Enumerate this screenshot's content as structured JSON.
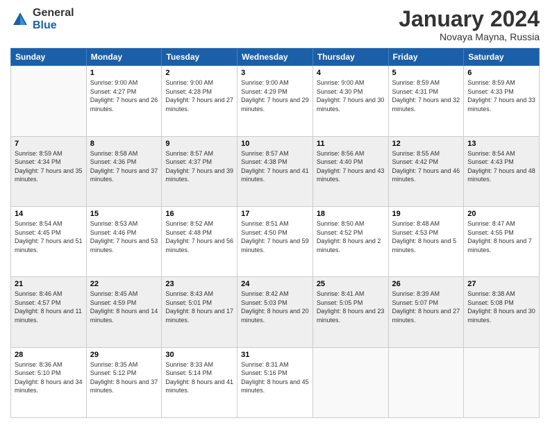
{
  "logo": {
    "general": "General",
    "blue": "Blue"
  },
  "header": {
    "month_year": "January 2024",
    "location": "Novaya Mayna, Russia"
  },
  "days_of_week": [
    "Sunday",
    "Monday",
    "Tuesday",
    "Wednesday",
    "Thursday",
    "Friday",
    "Saturday"
  ],
  "weeks": [
    [
      {
        "day": "",
        "sunrise": "",
        "sunset": "",
        "daylight": ""
      },
      {
        "day": "1",
        "sunrise": "Sunrise: 9:00 AM",
        "sunset": "Sunset: 4:27 PM",
        "daylight": "Daylight: 7 hours and 26 minutes."
      },
      {
        "day": "2",
        "sunrise": "Sunrise: 9:00 AM",
        "sunset": "Sunset: 4:28 PM",
        "daylight": "Daylight: 7 hours and 27 minutes."
      },
      {
        "day": "3",
        "sunrise": "Sunrise: 9:00 AM",
        "sunset": "Sunset: 4:29 PM",
        "daylight": "Daylight: 7 hours and 29 minutes."
      },
      {
        "day": "4",
        "sunrise": "Sunrise: 9:00 AM",
        "sunset": "Sunset: 4:30 PM",
        "daylight": "Daylight: 7 hours and 30 minutes."
      },
      {
        "day": "5",
        "sunrise": "Sunrise: 8:59 AM",
        "sunset": "Sunset: 4:31 PM",
        "daylight": "Daylight: 7 hours and 32 minutes."
      },
      {
        "day": "6",
        "sunrise": "Sunrise: 8:59 AM",
        "sunset": "Sunset: 4:33 PM",
        "daylight": "Daylight: 7 hours and 33 minutes."
      }
    ],
    [
      {
        "day": "7",
        "sunrise": "Sunrise: 8:59 AM",
        "sunset": "Sunset: 4:34 PM",
        "daylight": "Daylight: 7 hours and 35 minutes."
      },
      {
        "day": "8",
        "sunrise": "Sunrise: 8:58 AM",
        "sunset": "Sunset: 4:36 PM",
        "daylight": "Daylight: 7 hours and 37 minutes."
      },
      {
        "day": "9",
        "sunrise": "Sunrise: 8:57 AM",
        "sunset": "Sunset: 4:37 PM",
        "daylight": "Daylight: 7 hours and 39 minutes."
      },
      {
        "day": "10",
        "sunrise": "Sunrise: 8:57 AM",
        "sunset": "Sunset: 4:38 PM",
        "daylight": "Daylight: 7 hours and 41 minutes."
      },
      {
        "day": "11",
        "sunrise": "Sunrise: 8:56 AM",
        "sunset": "Sunset: 4:40 PM",
        "daylight": "Daylight: 7 hours and 43 minutes."
      },
      {
        "day": "12",
        "sunrise": "Sunrise: 8:55 AM",
        "sunset": "Sunset: 4:42 PM",
        "daylight": "Daylight: 7 hours and 46 minutes."
      },
      {
        "day": "13",
        "sunrise": "Sunrise: 8:54 AM",
        "sunset": "Sunset: 4:43 PM",
        "daylight": "Daylight: 7 hours and 48 minutes."
      }
    ],
    [
      {
        "day": "14",
        "sunrise": "Sunrise: 8:54 AM",
        "sunset": "Sunset: 4:45 PM",
        "daylight": "Daylight: 7 hours and 51 minutes."
      },
      {
        "day": "15",
        "sunrise": "Sunrise: 8:53 AM",
        "sunset": "Sunset: 4:46 PM",
        "daylight": "Daylight: 7 hours and 53 minutes."
      },
      {
        "day": "16",
        "sunrise": "Sunrise: 8:52 AM",
        "sunset": "Sunset: 4:48 PM",
        "daylight": "Daylight: 7 hours and 56 minutes."
      },
      {
        "day": "17",
        "sunrise": "Sunrise: 8:51 AM",
        "sunset": "Sunset: 4:50 PM",
        "daylight": "Daylight: 7 hours and 59 minutes."
      },
      {
        "day": "18",
        "sunrise": "Sunrise: 8:50 AM",
        "sunset": "Sunset: 4:52 PM",
        "daylight": "Daylight: 8 hours and 2 minutes."
      },
      {
        "day": "19",
        "sunrise": "Sunrise: 8:48 AM",
        "sunset": "Sunset: 4:53 PM",
        "daylight": "Daylight: 8 hours and 5 minutes."
      },
      {
        "day": "20",
        "sunrise": "Sunrise: 8:47 AM",
        "sunset": "Sunset: 4:55 PM",
        "daylight": "Daylight: 8 hours and 7 minutes."
      }
    ],
    [
      {
        "day": "21",
        "sunrise": "Sunrise: 8:46 AM",
        "sunset": "Sunset: 4:57 PM",
        "daylight": "Daylight: 8 hours and 11 minutes."
      },
      {
        "day": "22",
        "sunrise": "Sunrise: 8:45 AM",
        "sunset": "Sunset: 4:59 PM",
        "daylight": "Daylight: 8 hours and 14 minutes."
      },
      {
        "day": "23",
        "sunrise": "Sunrise: 8:43 AM",
        "sunset": "Sunset: 5:01 PM",
        "daylight": "Daylight: 8 hours and 17 minutes."
      },
      {
        "day": "24",
        "sunrise": "Sunrise: 8:42 AM",
        "sunset": "Sunset: 5:03 PM",
        "daylight": "Daylight: 8 hours and 20 minutes."
      },
      {
        "day": "25",
        "sunrise": "Sunrise: 8:41 AM",
        "sunset": "Sunset: 5:05 PM",
        "daylight": "Daylight: 8 hours and 23 minutes."
      },
      {
        "day": "26",
        "sunrise": "Sunrise: 8:39 AM",
        "sunset": "Sunset: 5:07 PM",
        "daylight": "Daylight: 8 hours and 27 minutes."
      },
      {
        "day": "27",
        "sunrise": "Sunrise: 8:38 AM",
        "sunset": "Sunset: 5:08 PM",
        "daylight": "Daylight: 8 hours and 30 minutes."
      }
    ],
    [
      {
        "day": "28",
        "sunrise": "Sunrise: 8:36 AM",
        "sunset": "Sunset: 5:10 PM",
        "daylight": "Daylight: 8 hours and 34 minutes."
      },
      {
        "day": "29",
        "sunrise": "Sunrise: 8:35 AM",
        "sunset": "Sunset: 5:12 PM",
        "daylight": "Daylight: 8 hours and 37 minutes."
      },
      {
        "day": "30",
        "sunrise": "Sunrise: 8:33 AM",
        "sunset": "Sunset: 5:14 PM",
        "daylight": "Daylight: 8 hours and 41 minutes."
      },
      {
        "day": "31",
        "sunrise": "Sunrise: 8:31 AM",
        "sunset": "Sunset: 5:16 PM",
        "daylight": "Daylight: 8 hours and 45 minutes."
      },
      {
        "day": "",
        "sunrise": "",
        "sunset": "",
        "daylight": ""
      },
      {
        "day": "",
        "sunrise": "",
        "sunset": "",
        "daylight": ""
      },
      {
        "day": "",
        "sunrise": "",
        "sunset": "",
        "daylight": ""
      }
    ]
  ]
}
